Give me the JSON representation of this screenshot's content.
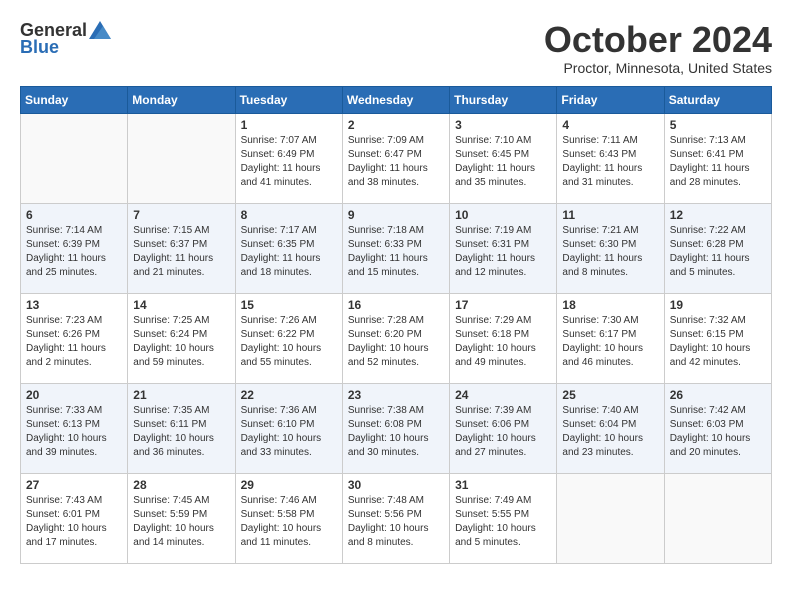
{
  "header": {
    "logo_general": "General",
    "logo_blue": "Blue",
    "month_title": "October 2024",
    "location": "Proctor, Minnesota, United States"
  },
  "weekdays": [
    "Sunday",
    "Monday",
    "Tuesday",
    "Wednesday",
    "Thursday",
    "Friday",
    "Saturday"
  ],
  "weeks": [
    [
      {
        "day": "",
        "info": ""
      },
      {
        "day": "",
        "info": ""
      },
      {
        "day": "1",
        "info": "Sunrise: 7:07 AM\nSunset: 6:49 PM\nDaylight: 11 hours and 41 minutes."
      },
      {
        "day": "2",
        "info": "Sunrise: 7:09 AM\nSunset: 6:47 PM\nDaylight: 11 hours and 38 minutes."
      },
      {
        "day": "3",
        "info": "Sunrise: 7:10 AM\nSunset: 6:45 PM\nDaylight: 11 hours and 35 minutes."
      },
      {
        "day": "4",
        "info": "Sunrise: 7:11 AM\nSunset: 6:43 PM\nDaylight: 11 hours and 31 minutes."
      },
      {
        "day": "5",
        "info": "Sunrise: 7:13 AM\nSunset: 6:41 PM\nDaylight: 11 hours and 28 minutes."
      }
    ],
    [
      {
        "day": "6",
        "info": "Sunrise: 7:14 AM\nSunset: 6:39 PM\nDaylight: 11 hours and 25 minutes."
      },
      {
        "day": "7",
        "info": "Sunrise: 7:15 AM\nSunset: 6:37 PM\nDaylight: 11 hours and 21 minutes."
      },
      {
        "day": "8",
        "info": "Sunrise: 7:17 AM\nSunset: 6:35 PM\nDaylight: 11 hours and 18 minutes."
      },
      {
        "day": "9",
        "info": "Sunrise: 7:18 AM\nSunset: 6:33 PM\nDaylight: 11 hours and 15 minutes."
      },
      {
        "day": "10",
        "info": "Sunrise: 7:19 AM\nSunset: 6:31 PM\nDaylight: 11 hours and 12 minutes."
      },
      {
        "day": "11",
        "info": "Sunrise: 7:21 AM\nSunset: 6:30 PM\nDaylight: 11 hours and 8 minutes."
      },
      {
        "day": "12",
        "info": "Sunrise: 7:22 AM\nSunset: 6:28 PM\nDaylight: 11 hours and 5 minutes."
      }
    ],
    [
      {
        "day": "13",
        "info": "Sunrise: 7:23 AM\nSunset: 6:26 PM\nDaylight: 11 hours and 2 minutes."
      },
      {
        "day": "14",
        "info": "Sunrise: 7:25 AM\nSunset: 6:24 PM\nDaylight: 10 hours and 59 minutes."
      },
      {
        "day": "15",
        "info": "Sunrise: 7:26 AM\nSunset: 6:22 PM\nDaylight: 10 hours and 55 minutes."
      },
      {
        "day": "16",
        "info": "Sunrise: 7:28 AM\nSunset: 6:20 PM\nDaylight: 10 hours and 52 minutes."
      },
      {
        "day": "17",
        "info": "Sunrise: 7:29 AM\nSunset: 6:18 PM\nDaylight: 10 hours and 49 minutes."
      },
      {
        "day": "18",
        "info": "Sunrise: 7:30 AM\nSunset: 6:17 PM\nDaylight: 10 hours and 46 minutes."
      },
      {
        "day": "19",
        "info": "Sunrise: 7:32 AM\nSunset: 6:15 PM\nDaylight: 10 hours and 42 minutes."
      }
    ],
    [
      {
        "day": "20",
        "info": "Sunrise: 7:33 AM\nSunset: 6:13 PM\nDaylight: 10 hours and 39 minutes."
      },
      {
        "day": "21",
        "info": "Sunrise: 7:35 AM\nSunset: 6:11 PM\nDaylight: 10 hours and 36 minutes."
      },
      {
        "day": "22",
        "info": "Sunrise: 7:36 AM\nSunset: 6:10 PM\nDaylight: 10 hours and 33 minutes."
      },
      {
        "day": "23",
        "info": "Sunrise: 7:38 AM\nSunset: 6:08 PM\nDaylight: 10 hours and 30 minutes."
      },
      {
        "day": "24",
        "info": "Sunrise: 7:39 AM\nSunset: 6:06 PM\nDaylight: 10 hours and 27 minutes."
      },
      {
        "day": "25",
        "info": "Sunrise: 7:40 AM\nSunset: 6:04 PM\nDaylight: 10 hours and 23 minutes."
      },
      {
        "day": "26",
        "info": "Sunrise: 7:42 AM\nSunset: 6:03 PM\nDaylight: 10 hours and 20 minutes."
      }
    ],
    [
      {
        "day": "27",
        "info": "Sunrise: 7:43 AM\nSunset: 6:01 PM\nDaylight: 10 hours and 17 minutes."
      },
      {
        "day": "28",
        "info": "Sunrise: 7:45 AM\nSunset: 5:59 PM\nDaylight: 10 hours and 14 minutes."
      },
      {
        "day": "29",
        "info": "Sunrise: 7:46 AM\nSunset: 5:58 PM\nDaylight: 10 hours and 11 minutes."
      },
      {
        "day": "30",
        "info": "Sunrise: 7:48 AM\nSunset: 5:56 PM\nDaylight: 10 hours and 8 minutes."
      },
      {
        "day": "31",
        "info": "Sunrise: 7:49 AM\nSunset: 5:55 PM\nDaylight: 10 hours and 5 minutes."
      },
      {
        "day": "",
        "info": ""
      },
      {
        "day": "",
        "info": ""
      }
    ]
  ]
}
